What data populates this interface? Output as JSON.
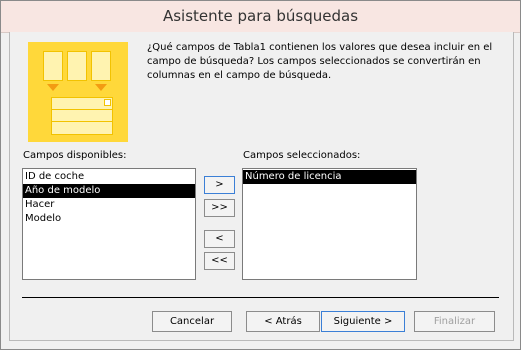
{
  "window": {
    "title": "Asistente para búsquedas"
  },
  "description": "¿Qué campos de Tabla1 contienen los valores que desea incluir en el campo de búsqueda? Los campos seleccionados se convertirán en columnas en el campo de búsqueda.",
  "available": {
    "label": "Campos disponibles:",
    "items": [
      "ID de coche",
      "Año de modelo",
      "Hacer",
      "Modelo"
    ],
    "selected_index": 1
  },
  "selected": {
    "label": "Campos seleccionados:",
    "items": [
      "Número de licencia"
    ],
    "selected_index": 0
  },
  "move_buttons": {
    "add": ">",
    "add_all": ">>",
    "remove": "<",
    "remove_all": "<<"
  },
  "footer": {
    "cancel": "Cancelar",
    "back": "< Atrás",
    "next": "Siguiente >",
    "finish": "Finalizar"
  },
  "colors": {
    "titlebar": "#f8e6e2",
    "illustration": "#ffd83a",
    "selection": "#000000"
  }
}
